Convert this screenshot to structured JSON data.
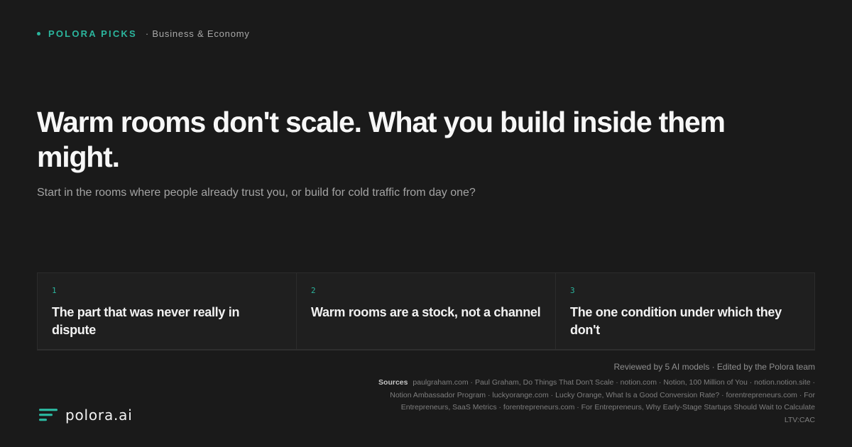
{
  "kicker": {
    "brand": "POLORA PICKS",
    "category": "· Business & Economy"
  },
  "headline": "Warm rooms don't scale. What you build inside them might.",
  "subhead": "Start in the rooms where people already trust you, or build for cold traffic from day one?",
  "cards": [
    {
      "num": "1",
      "title": "The part that was never really in dispute"
    },
    {
      "num": "2",
      "title": "Warm rooms are a stock, not a channel"
    },
    {
      "num": "3",
      "title": "The one condition under which they don't"
    }
  ],
  "footer": {
    "review": "Reviewed by 5 AI models · Edited by the Polora team",
    "sources_label": "Sources",
    "sources": "paulgraham.com · Paul Graham, Do Things That Don't Scale · notion.com · Notion, 100 Million of You · notion.notion.site · Notion Ambassador Program · luckyorange.com · Lucky Orange, What Is a Good Conversion Rate? · forentrepreneurs.com · For Entrepreneurs, SaaS Metrics · forentrepreneurs.com · For Entrepreneurs, Why Early-Stage Startups Should Wait to Calculate LTV:CAC",
    "logo_text": "polora.ai",
    "logo_icon": "polora-logo-icon"
  },
  "colors": {
    "background": "#1a1a1a",
    "accent": "#2bb59d"
  }
}
